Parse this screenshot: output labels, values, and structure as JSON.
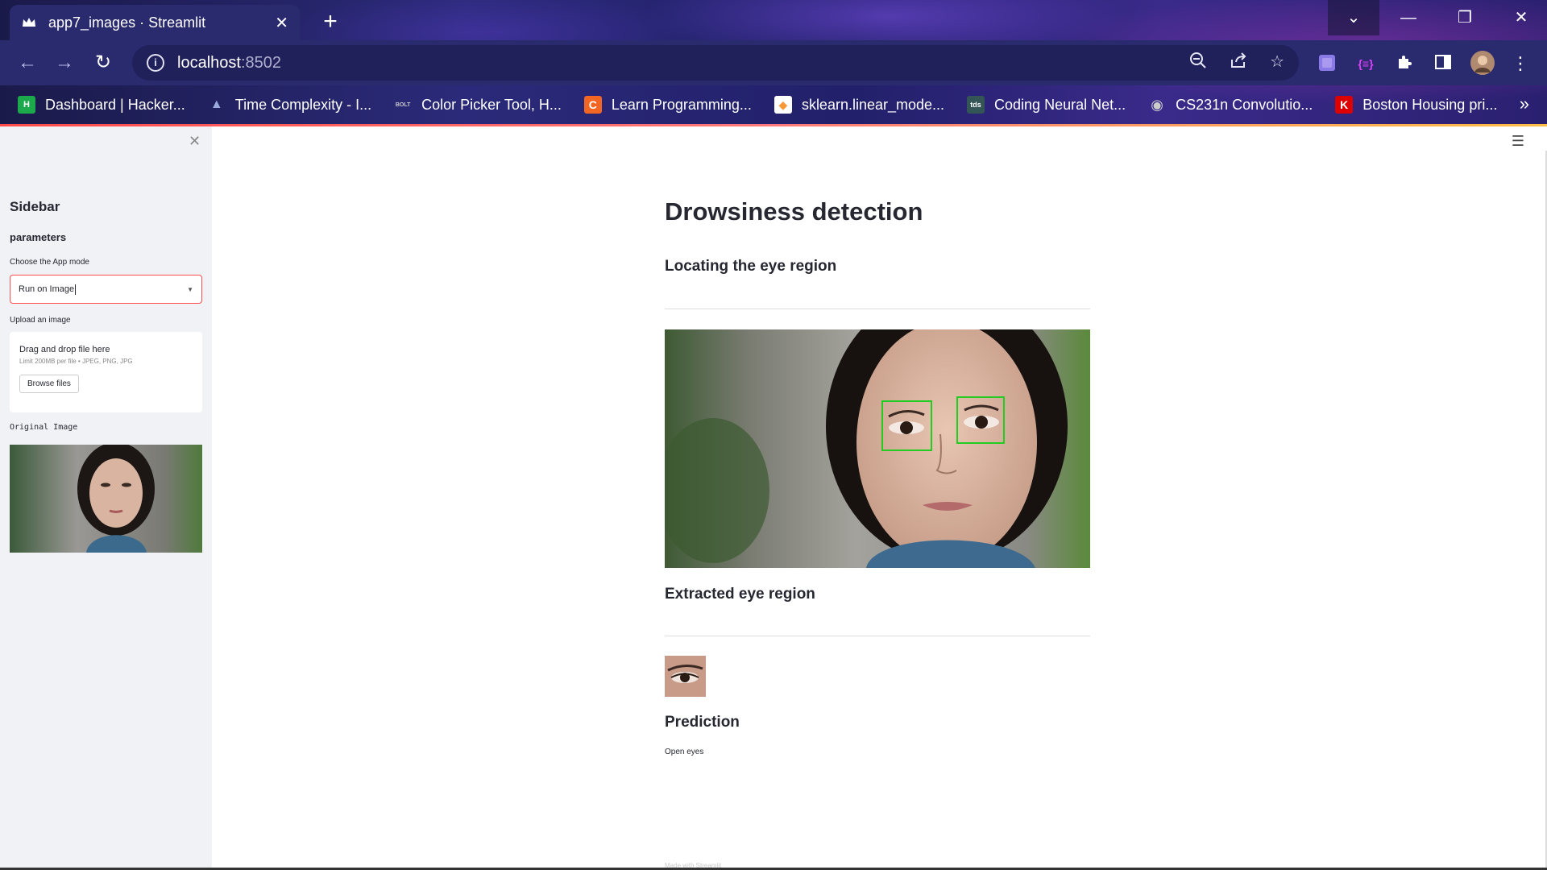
{
  "browser": {
    "tab_title": "app7_images · Streamlit",
    "tab_close": "✕",
    "new_tab": "+",
    "url_host": "localhost",
    "url_port": ":8502",
    "bookmarks": [
      {
        "label": "Dashboard | Hacker...",
        "icon": "hackerrank-icon",
        "glyph": "H",
        "bg": "#1ba94c",
        "fg": "#fff"
      },
      {
        "label": "Time Complexity - I...",
        "icon": "mountain-icon",
        "glyph": "▲",
        "bg": "transparent",
        "fg": "#9ad"
      },
      {
        "label": "Color Picker Tool, H...",
        "icon": "bolt-icon",
        "glyph": "BOLT",
        "bg": "transparent",
        "fg": "#ccc"
      },
      {
        "label": "Learn Programming...",
        "icon": "codecademy-icon",
        "glyph": "C",
        "bg": "#f26522",
        "fg": "#fff"
      },
      {
        "label": "sklearn.linear_mode...",
        "icon": "sklearn-icon",
        "glyph": "◆",
        "bg": "#fff",
        "fg": "#f89939"
      },
      {
        "label": "Coding Neural Net...",
        "icon": "tds-icon",
        "glyph": "tds",
        "bg": "#355",
        "fg": "#fff"
      },
      {
        "label": "CS231n Convolutio...",
        "icon": "globe-icon",
        "glyph": "◉",
        "bg": "transparent",
        "fg": "#ccc"
      },
      {
        "label": "Boston Housing pri...",
        "icon": "kaggle-icon",
        "glyph": "K",
        "bg": "#d00",
        "fg": "#fff"
      }
    ],
    "bookmarks_more": "»"
  },
  "sidebar": {
    "title": "Sidebar",
    "subtitle": "parameters",
    "mode_label": "Choose the App mode",
    "mode_value": "Run on Image",
    "upload_label": "Upload an image",
    "upload_main": "Drag and drop file here",
    "upload_limit": "Limit 200MB per file • JPEG, PNG, JPG",
    "browse_label": "Browse files",
    "original_caption": "Original Image"
  },
  "main": {
    "title": "Drowsiness detection",
    "section_locate": "Locating the eye region",
    "section_extract": "Extracted eye region",
    "section_prediction": "Prediction",
    "prediction_value": "Open eyes",
    "footer": "Made with Streamlit"
  },
  "colors": {
    "accent": "#ff4b4b",
    "detection_box": "#22cc22"
  }
}
